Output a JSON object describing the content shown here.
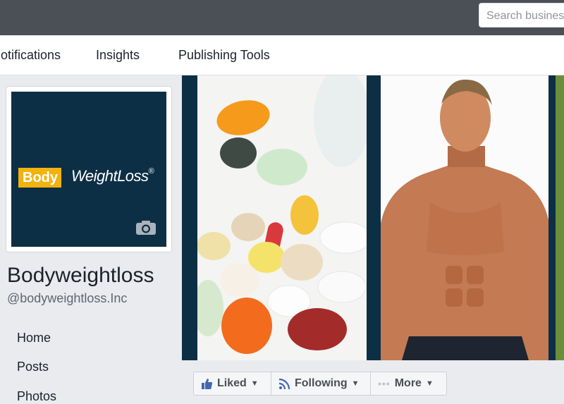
{
  "topbar": {
    "search_placeholder": "Search businesses"
  },
  "nav": {
    "tabs": [
      {
        "label": "Notifications"
      },
      {
        "label": "Insights"
      },
      {
        "label": "Publishing Tools"
      }
    ]
  },
  "profile": {
    "logo_body": "Body",
    "logo_weightloss": "WeightLoss",
    "logo_reg": "®",
    "name": "Bodyweightloss",
    "handle": "@bodyweightloss.Inc"
  },
  "sidebar": {
    "items": [
      {
        "label": "Home"
      },
      {
        "label": "Posts"
      },
      {
        "label": "Photos"
      }
    ]
  },
  "actions": {
    "liked": "Liked",
    "following": "Following",
    "more": "More"
  },
  "colors": {
    "topbar": "#4b4f56",
    "cover_bg": "#0d2f45",
    "logo_yellow": "#f2b30e",
    "like_blue": "#4267b2"
  },
  "icons": [
    "camera-icon",
    "thumbs-up-icon",
    "rss-icon",
    "more-dots-icon",
    "caret-down-icon"
  ]
}
